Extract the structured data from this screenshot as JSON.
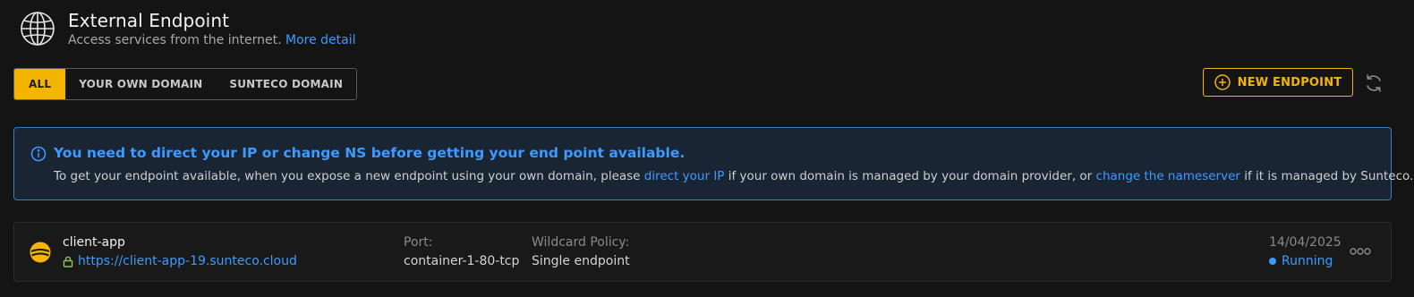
{
  "header": {
    "title": "External Endpoint",
    "subtitle": "Access services from the internet.",
    "more_link": "More detail",
    "icon": "globe-icon"
  },
  "tabs": [
    {
      "label": "ALL",
      "active": true
    },
    {
      "label": "YOUR OWN DOMAIN",
      "active": false
    },
    {
      "label": "SUNTECO DOMAIN",
      "active": false
    }
  ],
  "actions": {
    "new_endpoint_label": "NEW ENDPOINT",
    "new_endpoint_icon": "plus-circle-icon",
    "refresh_icon": "refresh-icon"
  },
  "alert": {
    "icon": "info-icon",
    "title": "You need to direct your IP or change NS before getting your end point available.",
    "body_part1": "To get your endpoint available, when you expose a new endpoint using your own domain, please ",
    "link1": "direct your IP",
    "body_part2": " if your own domain is managed by your domain provider, or ",
    "link2": "change the nameserver",
    "body_part3": " if it is managed by Sunteco."
  },
  "endpoints": [
    {
      "name": "client-app",
      "url": "https://client-app-19.sunteco.cloud",
      "port_label": "Port:",
      "port_value": "container-1-80-tcp",
      "wildcard_label": "Wildcard Policy:",
      "wildcard_value": "Single endpoint",
      "date": "14/04/2025",
      "status": "Running"
    }
  ],
  "colors": {
    "accent": "#f5b400",
    "link": "#3d9bff",
    "background": "#141414",
    "alert_bg": "#1a2534",
    "alert_border": "#2f7fd6",
    "lock": "#8bc34a"
  }
}
